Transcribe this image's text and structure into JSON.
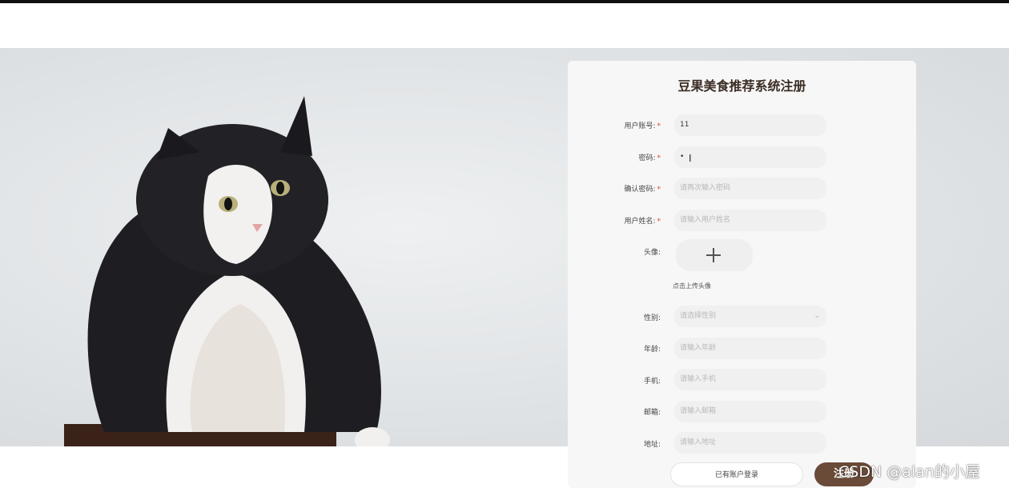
{
  "colors": {
    "accent": "#6a4a38",
    "required": "#e0443b"
  },
  "form": {
    "title": "豆果美食推荐系统注册",
    "account": {
      "label": "用户账号:",
      "value": "11",
      "required": "*"
    },
    "password": {
      "label": "密码:",
      "value": "•",
      "required": "*"
    },
    "confirm": {
      "label": "确认密码:",
      "placeholder": "请再次输入密码",
      "required": "*"
    },
    "name": {
      "label": "用户姓名:",
      "placeholder": "请输入用户姓名",
      "required": "*"
    },
    "avatar": {
      "label": "头像:",
      "hint": "点击上传头像",
      "icon": "plus-icon"
    },
    "gender": {
      "label": "性别:",
      "placeholder": "请选择性别",
      "icon": "chevron-down-icon"
    },
    "age": {
      "label": "年龄:",
      "placeholder": "请输入年龄"
    },
    "phone": {
      "label": "手机:",
      "placeholder": "请输入手机"
    },
    "email": {
      "label": "邮箱:",
      "placeholder": "请输入邮箱"
    },
    "address": {
      "label": "地址:",
      "placeholder": "请输入地址"
    },
    "login_label": "已有账户登录",
    "register_label": "注册"
  },
  "watermark": "CSDN @alan的小屋"
}
